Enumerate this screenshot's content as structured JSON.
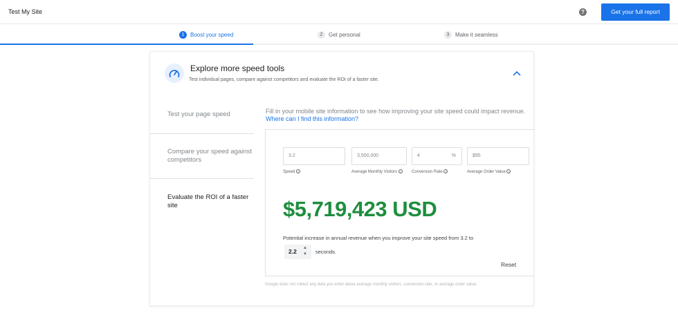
{
  "header": {
    "site_title": "Test My Site",
    "help_icon": "?",
    "report_button": "Get your full report"
  },
  "steps": [
    {
      "num": "1",
      "label": "Boost your speed",
      "active": true
    },
    {
      "num": "2",
      "label": "Get personal",
      "active": false
    },
    {
      "num": "3",
      "label": "Make it seamless",
      "active": false
    }
  ],
  "card": {
    "title": "Explore more speed tools",
    "subtitle": "Test individual pages, compare against competitors and evaluate the ROI of a faster site.",
    "nav": {
      "item1": "Test your page speed",
      "item2": "Compare your speed against competitors",
      "item3": "Evaluate the ROI of a faster site"
    },
    "intro_text": "Fill in your mobile site information to see how improving your site speed could impact revenue.",
    "intro_link": "Where can I find this information?",
    "fields": {
      "speed": {
        "value": "3.2",
        "label": "Speed"
      },
      "visitors": {
        "value": "3,500,000",
        "label": "Average Monthly Visitors"
      },
      "conversion": {
        "value": "4",
        "unit": "%",
        "label": "Conversion Rate"
      },
      "order": {
        "value": "$95",
        "label": "Average Order Value"
      }
    },
    "revenue": "$5,719,423 USD",
    "potential_text": "Potential increase in annual revenue when you improve your site speed from 3.2 to",
    "target_speed": "2.2",
    "seconds_text": "seconds.",
    "reset_label": "Reset",
    "disclaimer": "Google does not collect any data you enter about average monthly visitors, conversion rate, or average order value."
  },
  "colors": {
    "accent": "#1a73e8",
    "revenue": "#1e8e3e"
  }
}
